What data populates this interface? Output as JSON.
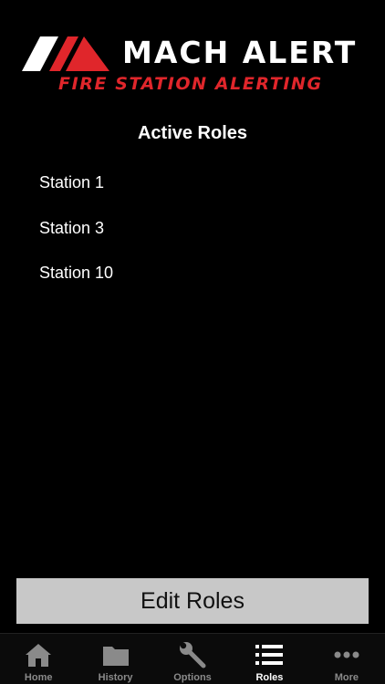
{
  "brand": {
    "title": "MACH ALERT",
    "subtitle": "FIRE STATION ALERTING",
    "colors": {
      "accent": "#e0262b",
      "logo_light": "#ffffff",
      "logo_red": "#e0262b"
    }
  },
  "section": {
    "title": "Active Roles"
  },
  "roles": [
    {
      "label": "Station 1"
    },
    {
      "label": "Station 3"
    },
    {
      "label": "Station 10"
    }
  ],
  "actions": {
    "edit_label": "Edit Roles"
  },
  "tabbar": {
    "active": "Roles",
    "tabs": [
      {
        "label": "Home",
        "icon": "home-icon"
      },
      {
        "label": "History",
        "icon": "folder-icon"
      },
      {
        "label": "Options",
        "icon": "wrench-icon"
      },
      {
        "label": "Roles",
        "icon": "list-icon"
      },
      {
        "label": "More",
        "icon": "more-icon"
      }
    ]
  }
}
